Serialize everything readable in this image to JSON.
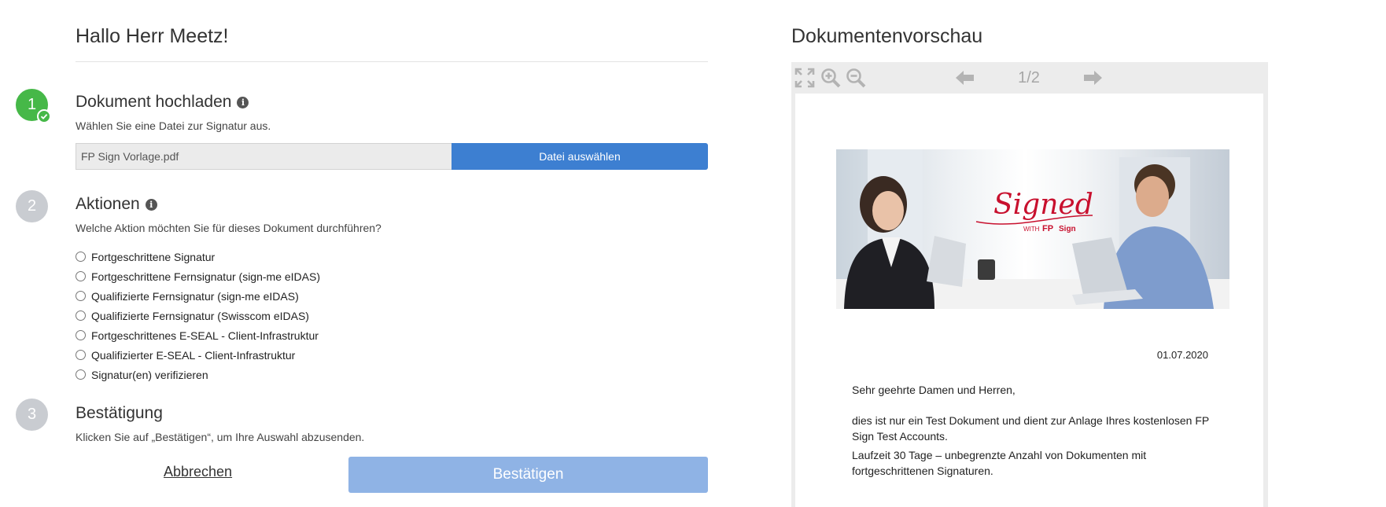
{
  "greeting": "Hallo Herr Meetz!",
  "steps": {
    "upload": {
      "number": "1",
      "title": "Dokument hochladen",
      "description": "Wählen Sie eine Datei zur Signatur aus.",
      "file_value": "FP Sign Vorlage.pdf",
      "file_button": "Datei auswählen"
    },
    "actions": {
      "number": "2",
      "title": "Aktionen",
      "description": "Welche Aktion möchten Sie für dieses Dokument durchführen?",
      "options": [
        "Fortgeschrittene Signatur",
        "Fortgeschrittene Fernsignatur (sign-me eIDAS)",
        "Qualifizierte Fernsignatur (sign-me eIDAS)",
        "Qualifizierte Fernsignatur (Swisscom eIDAS)",
        "Fortgeschrittenes E-SEAL - Client-Infrastruktur",
        "Qualifizierter E-SEAL - Client-Infrastruktur",
        "Signatur(en) verifizieren"
      ]
    },
    "confirm": {
      "number": "3",
      "title": "Bestätigung",
      "description": "Klicken Sie auf „Bestätigen“, um Ihre Auswahl abzusenden."
    }
  },
  "buttons": {
    "cancel": "Abbrechen",
    "confirm": "Bestätigen"
  },
  "preview": {
    "title": "Dokumentenvorschau",
    "page_indicator": "1/2",
    "toolbar_icons": [
      "fullscreen-icon",
      "zoom-in-icon",
      "zoom-out-icon",
      "arrow-left-icon",
      "arrow-right-icon"
    ],
    "banner": {
      "script_text": "Signed",
      "with_text": "WITH",
      "brand_text": "FP",
      "sign_text": "Sign"
    },
    "document": {
      "date": "01.07.2020",
      "salutation": "Sehr geehrte Damen und Herren,",
      "paragraph1": "dies ist nur ein Test Dokument und dient zur Anlage Ihres kostenlosen FP Sign Test Accounts.",
      "paragraph2": "Laufzeit 30 Tage – unbegrenzte Anzahl von Dokumenten mit fortgeschrittenen Signaturen."
    }
  },
  "colors": {
    "step_done": "#46b848",
    "step_todo": "#c9ccd1",
    "primary_button": "#3d7fd1",
    "confirm_button_disabled": "#8fb3e5",
    "brand_red": "#c8102e"
  }
}
